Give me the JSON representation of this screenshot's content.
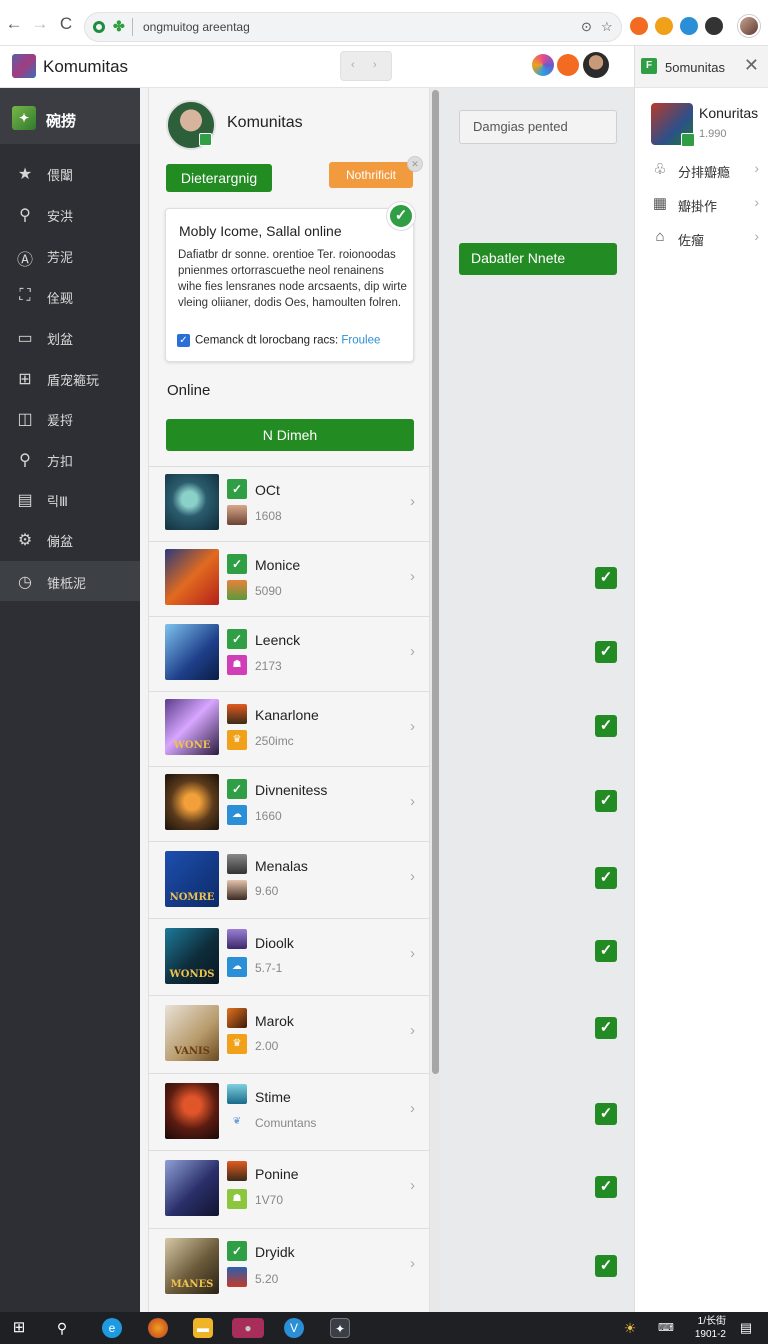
{
  "browser": {
    "back": "←",
    "forward": "→",
    "reload": "C",
    "url": "ongmuitog areentag",
    "url_icons": [
      "⊙",
      "☆"
    ],
    "extensions": [
      {
        "name": "orange-extension-icon",
        "color": "#f26b21",
        "glyph": "●"
      },
      {
        "name": "amber-extension-icon",
        "color": "#f0a019",
        "glyph": "●"
      },
      {
        "name": "blue-extension-icon",
        "color": "#2a8fd6",
        "glyph": "▣"
      },
      {
        "name": "soccer-extension-icon",
        "color": "#333333",
        "glyph": "◉"
      }
    ]
  },
  "app": {
    "title": "Komumitas",
    "header_tool_left": "‹",
    "header_tool_right": "›"
  },
  "side_panel": {
    "tab_label": "5omunitas",
    "tab_icon": "F",
    "close": "✕",
    "item_title": "Konuritas",
    "item_sub": "1.990",
    "menu": [
      {
        "icon": "♧",
        "label": "分排瓣瘾"
      },
      {
        "icon": "▦",
        "label": "瓣掛作"
      },
      {
        "icon": "⌂",
        "label": "佐瘤"
      }
    ]
  },
  "sidebar": {
    "header": "碗捞",
    "items": [
      {
        "icon": "★",
        "label": "偎闈"
      },
      {
        "icon": "⚲",
        "label": "安洪"
      },
      {
        "icon": "Ⓐ",
        "label": "芳泥"
      },
      {
        "icon": "⛶",
        "label": "佺觋"
      },
      {
        "icon": "▭",
        "label": "划盆"
      },
      {
        "icon": "⊞",
        "label": "盾宠篐玩"
      },
      {
        "icon": "◫",
        "label": "爰捋"
      },
      {
        "icon": "⚲",
        "label": "方扣"
      },
      {
        "icon": "▤",
        "label": "릭Ⅲ"
      },
      {
        "icon": "⚙",
        "label": "傰盆"
      },
      {
        "icon": "◷",
        "label": "锥柢泥"
      }
    ]
  },
  "profile": {
    "name": "Komunitas",
    "primary_button": "Dieterargnig",
    "orange_button": "Nothrificit"
  },
  "info_card": {
    "title": "Mobly Icome, Sallal online",
    "body": "Dafiatbr dr sonne. orentioe Ter. roionoodas pnienmes ortorrascuethe neol renainens wihe fies lensranes node arcsaents, dip wirte vleing oliianer, dodis Oes, hamoulten folren.",
    "checkbox_text": "Cemanck dt lorocbang racs:",
    "link": "Froulee"
  },
  "online": {
    "heading": "Online",
    "button": "N Dimeh"
  },
  "games": [
    {
      "name": "OCt",
      "sub": "1608"
    },
    {
      "name": "Monice",
      "sub": "5090"
    },
    {
      "name": "Leenck",
      "sub": "2173"
    },
    {
      "name": "Kanarlone",
      "sub": "250imc"
    },
    {
      "name": "Divnenitess",
      "sub": "1660"
    },
    {
      "name": "Menalas",
      "sub": "9.60"
    },
    {
      "name": "Dioolk",
      "sub": "5.7-1"
    },
    {
      "name": "Marok",
      "sub": "2.00"
    },
    {
      "name": "Stime",
      "sub": "Comuntans"
    },
    {
      "name": "Ponine",
      "sub": "1V70"
    },
    {
      "name": "Dryidk",
      "sub": "5.20"
    }
  ],
  "content": {
    "input_placeholder": "Damgias pented",
    "button": "Dabatler Nnete"
  },
  "taskbar": {
    "time": "1/长街",
    "date": "1901-2"
  },
  "colors": {
    "accent_green": "#238b24",
    "orange": "#f19a3e",
    "sidebar_bg": "#2d2f34"
  }
}
